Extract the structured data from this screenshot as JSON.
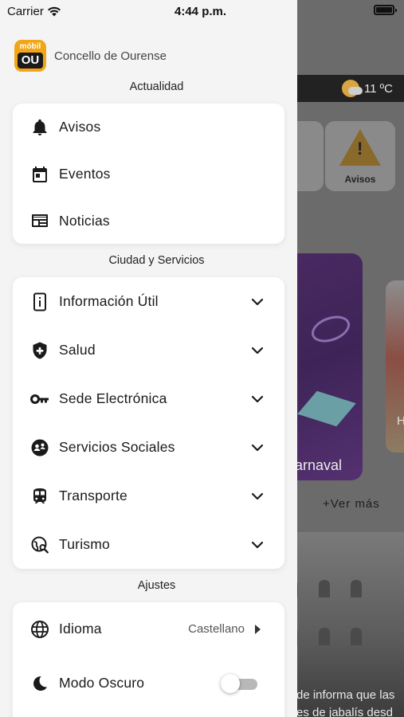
{
  "status_bar": {
    "carrier": "Carrier",
    "time": "4:44 p.m."
  },
  "brand": {
    "logo_top": "móbil",
    "logo_bottom": "OU",
    "name": "Concello de Ourense"
  },
  "sections": {
    "actualidad": {
      "title": "Actualidad",
      "items": [
        {
          "label": "Avisos",
          "icon": "bell-icon"
        },
        {
          "label": "Eventos",
          "icon": "calendar-icon"
        },
        {
          "label": "Noticias",
          "icon": "newspaper-icon"
        }
      ]
    },
    "ciudad": {
      "title": "Ciudad y Servicios",
      "items": [
        {
          "label": "Información Útil",
          "icon": "info-icon"
        },
        {
          "label": "Salud",
          "icon": "health-shield-icon"
        },
        {
          "label": "Sede Electrónica",
          "icon": "key-icon"
        },
        {
          "label": "Servicios Sociales",
          "icon": "social-services-icon"
        },
        {
          "label": "Transporte",
          "icon": "train-icon"
        },
        {
          "label": "Turismo",
          "icon": "travel-explore-icon"
        }
      ]
    },
    "ajustes": {
      "title": "Ajustes",
      "items": [
        {
          "label": "Idioma",
          "value": "Castellano",
          "icon": "globe-icon"
        },
        {
          "label": "Modo Oscuro",
          "toggle": false,
          "icon": "moon-icon"
        }
      ]
    }
  },
  "background": {
    "weather": "11 ºC",
    "tile_label": "Avisos",
    "carnaval_label": "arnaval",
    "right_card_letter": "H",
    "ver_mas": "+Ver más",
    "news_line_1": "de informa que las",
    "news_line_2": "es de jabalís desd"
  },
  "colors": {
    "drawer_bg": "#f4f4f4",
    "card_bg": "#ffffff",
    "brand_orange": "#f2a516",
    "icon": "#1a1a1a"
  }
}
